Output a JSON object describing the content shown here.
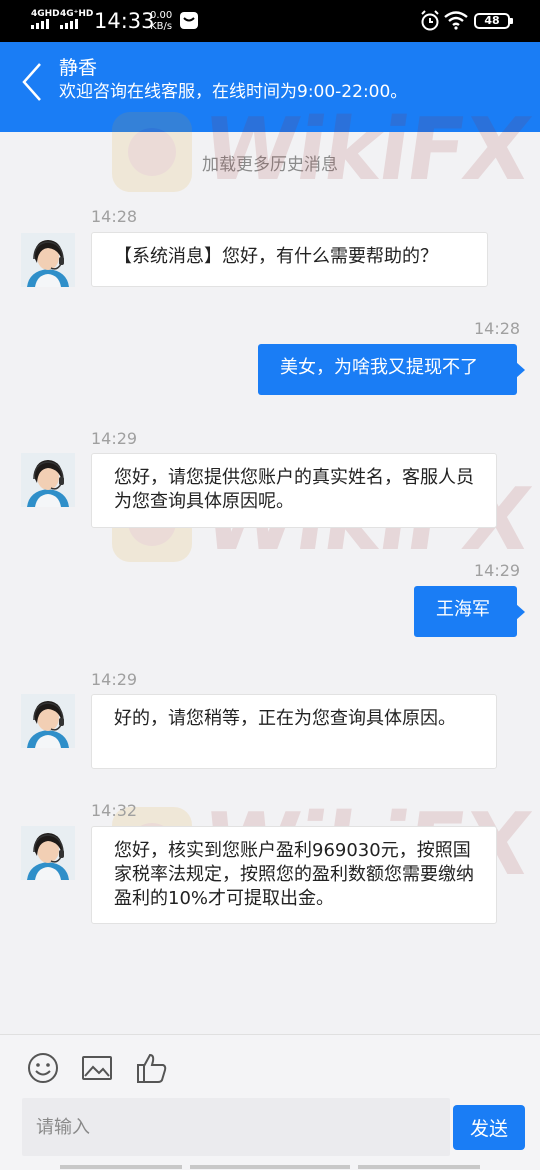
{
  "status_bar": {
    "net1": "4GHD",
    "net2": "4G⁺HD",
    "time": "14:33",
    "speed_value": "0.00",
    "speed_unit": "KB/s",
    "battery": "48"
  },
  "header": {
    "title": "静香",
    "subtitle": "欢迎咨询在线客服，在线时间为9:00-22:00。"
  },
  "load_more": "加载更多历史消息",
  "watermark": "WikiFX",
  "messages": [
    {
      "time": "14:28",
      "text": "【系统消息】您好，有什么需要帮助的？",
      "side": "in"
    },
    {
      "time": "14:28",
      "text": "美女，为啥我又提现不了",
      "side": "out"
    },
    {
      "time": "14:29",
      "text": "您好，请您提供您账户的真实姓名，客服人员为您查询具体原因呢。",
      "side": "in"
    },
    {
      "time": "14:29",
      "text": "王海军",
      "side": "out"
    },
    {
      "time": "14:29",
      "text": "好的，请您稍等，正在为您查询具体原因。",
      "side": "in"
    },
    {
      "time": "14:32",
      "text": "您好，核实到您账户盈利969030元，按照国家税率法规定，按照您的盈利数额您需要缴纳盈利的10%才可提取出金。",
      "side": "in"
    }
  ],
  "composer": {
    "placeholder": "请输入",
    "send_label": "发送",
    "tools": [
      "emoji-icon",
      "image-icon",
      "thumbs-up-icon"
    ]
  },
  "colors": {
    "accent": "#1a7df5",
    "status_bar": "#000000",
    "background": "#f2f2f4"
  }
}
